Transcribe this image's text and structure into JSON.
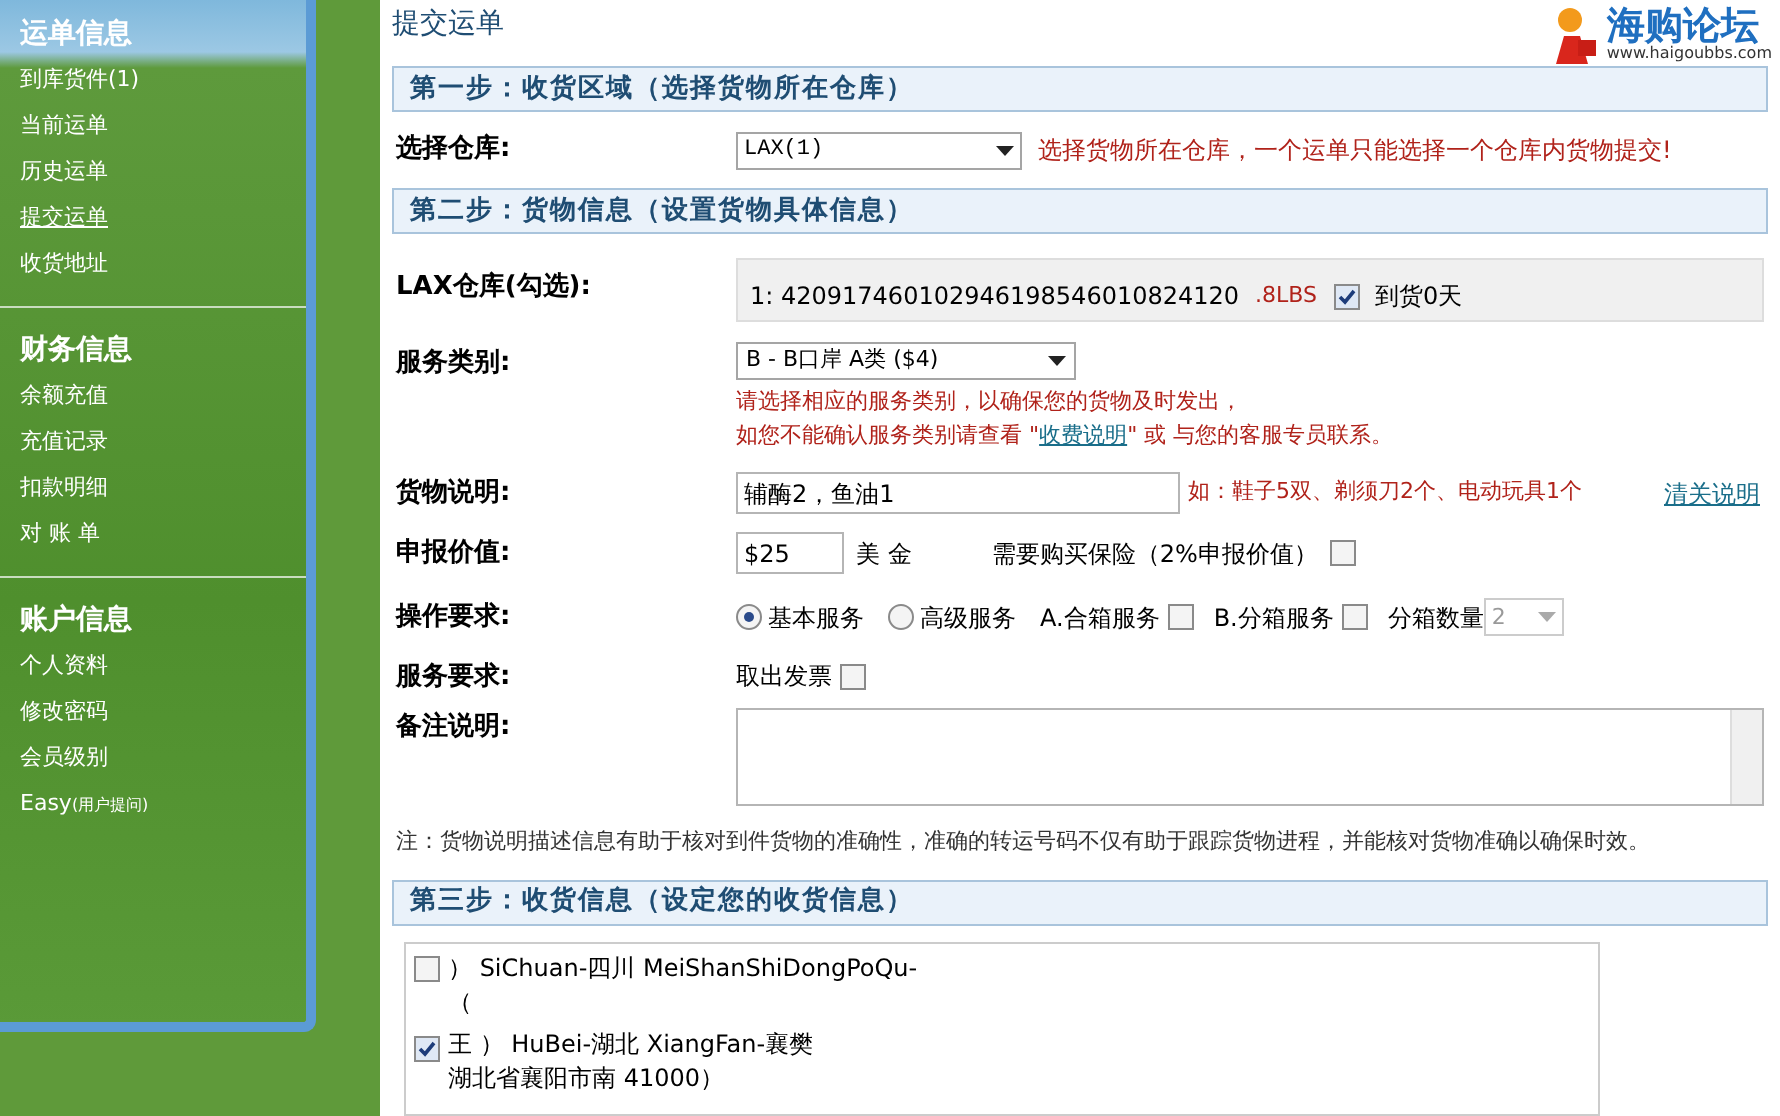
{
  "sidebar": {
    "sections": [
      {
        "title": "运单信息",
        "items": [
          {
            "label": "到库货件(1)",
            "selected": false
          },
          {
            "label": "当前运单",
            "selected": false
          },
          {
            "label": "历史运单",
            "selected": false
          },
          {
            "label": "提交运单",
            "selected": true
          },
          {
            "label": "收货地址",
            "selected": false
          }
        ]
      },
      {
        "title": "财务信息",
        "items": [
          {
            "label": "余额充值",
            "selected": false
          },
          {
            "label": "充值记录",
            "selected": false
          },
          {
            "label": "扣款明细",
            "selected": false
          },
          {
            "label": "对 账 单",
            "selected": false
          }
        ]
      },
      {
        "title": "账户信息",
        "items": [
          {
            "label": "个人资料",
            "selected": false
          },
          {
            "label": "修改密码",
            "selected": false
          },
          {
            "label": "会员级别",
            "selected": false
          },
          {
            "label": "Easy",
            "note": "(用户提问)",
            "selected": false
          }
        ]
      }
    ]
  },
  "page_title": "提交运单",
  "logo": {
    "name": "海购论坛",
    "url": "www.haigoubbs.com"
  },
  "step1": {
    "header": "第一步：收货区域（选择货物所在仓库）",
    "label": "选择仓库:",
    "value": "LAX(1)",
    "hint": "选择货物所在仓库，一个运单只能选择一个仓库内货物提交!"
  },
  "step2": {
    "header": "第二步：货物信息（设置货物具体信息）",
    "warehouse": {
      "label": "LAX仓库(勾选):",
      "parcels": [
        {
          "tracking": "1: 420917460102946198546010824120",
          "weight": ".8LBS",
          "checked": true,
          "days": "到货0天"
        }
      ]
    },
    "service": {
      "label": "服务类别:",
      "value": "B - B口岸 A类 ($4)",
      "note_1": "请选择相应的服务类别，以确保您的货物及时发出，",
      "note_2_before": "如您不能确认服务类别请查看 \"",
      "note_link": "收费说明",
      "note_2_after": "\" 或 与您的客服专员联系。"
    },
    "goods": {
      "label": "货物说明:",
      "value": "辅酶2，鱼油1",
      "example": "如：鞋子5双、剃须刀2个、电动玩具1个",
      "link": "清关说明"
    },
    "declared": {
      "label": "申报价值:",
      "value": "$25",
      "currency": "美 金",
      "insurance": "需要购买保险（2%申报价值）",
      "insurance_checked": false
    },
    "operation": {
      "label": "操作要求:",
      "options": [
        {
          "label": "基本服务",
          "selected": true
        },
        {
          "label": "高级服务",
          "selected": false
        }
      ],
      "checks": [
        {
          "label": "A.合箱服务",
          "checked": false
        },
        {
          "label": "B.分箱服务",
          "checked": false
        }
      ],
      "count_label": "分箱数量",
      "count_value": "2"
    },
    "service_req": {
      "label": "服务要求:",
      "option": "取出发票",
      "checked": false
    },
    "remark": {
      "label": "备注说明:"
    },
    "note": "注：货物说明描述信息有助于核对到件货物的准确性，准确的转运号码不仅有助于跟踪货物进程，并能核对货物准确以确保时效。"
  },
  "step3": {
    "header": "第三步：收货信息（设定您的收货信息）",
    "addresses": [
      {
        "checked": false,
        "line_1": "） SiChuan-四川 MeiShanShiDongPoQu-",
        "line_2": "（"
      },
      {
        "checked": true,
        "line_1": "王 ） HuBei-湖北 XiangFan-襄樊",
        "line_2": "湖北省襄阳市南 41000）"
      }
    ]
  }
}
